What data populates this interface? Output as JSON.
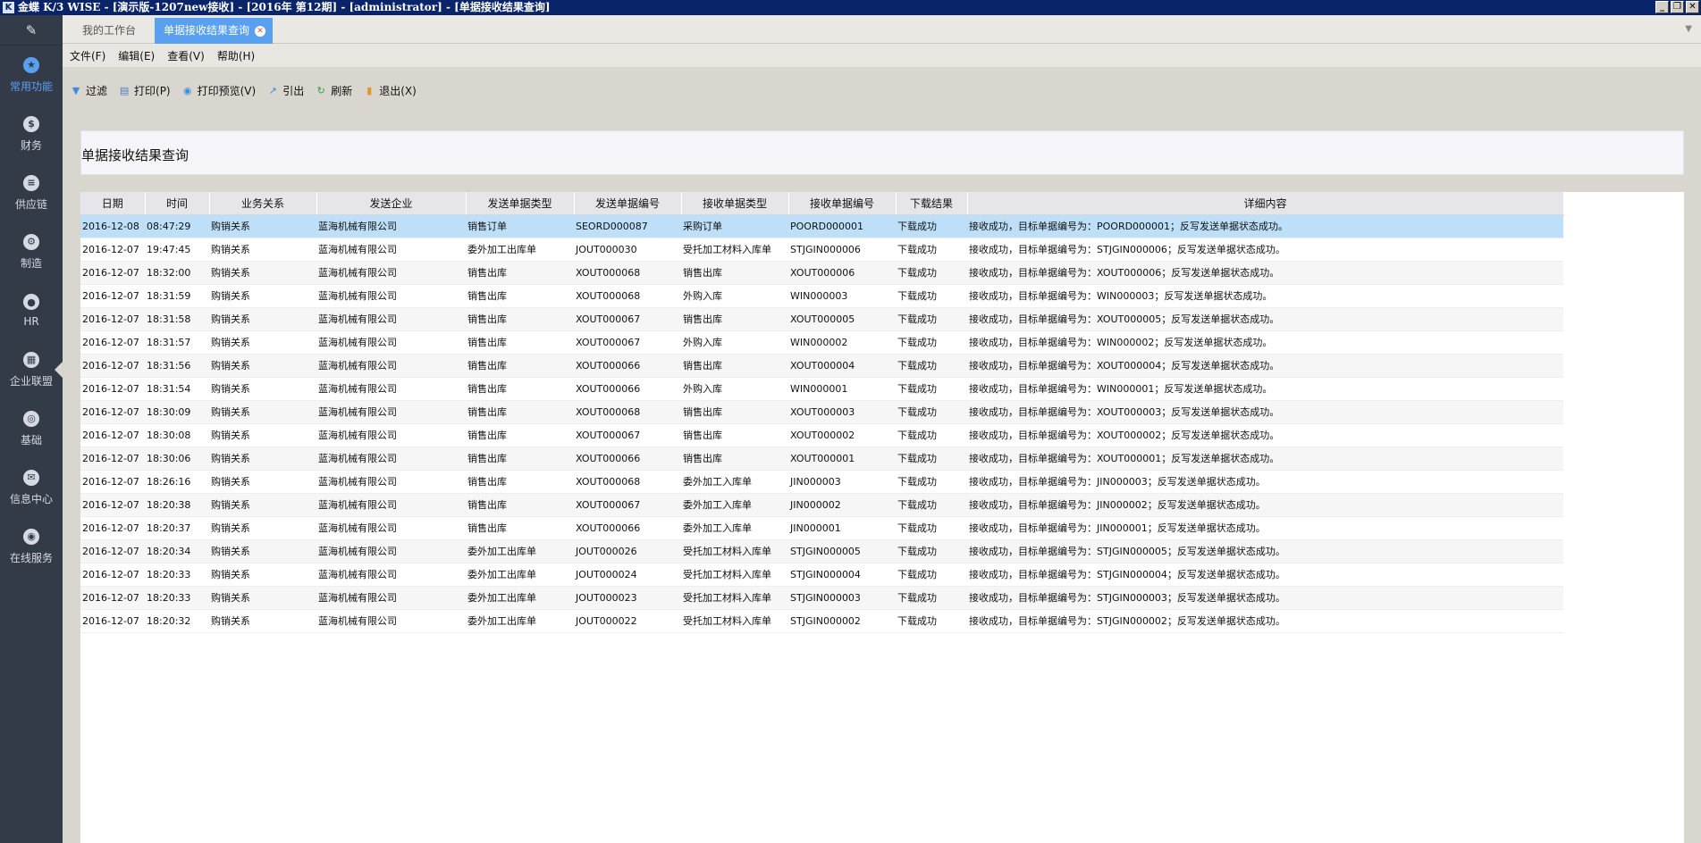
{
  "titlebar": {
    "logo": "K",
    "title": "金蝶 K/3 WISE - [演示版-1207new接收] - [2016年 第12期] - [administrator] - [单据接收结果查询]",
    "minimize": "_",
    "restore": "❐",
    "close": "✕"
  },
  "sidebar": {
    "top_icon": "edit-icon",
    "top_glyph": "✎",
    "items": [
      {
        "label": "常用功能",
        "icon": "star-icon",
        "glyph": "★"
      },
      {
        "label": "财务",
        "icon": "dollar-icon",
        "glyph": "$"
      },
      {
        "label": "供应链",
        "icon": "database-icon",
        "glyph": "≡"
      },
      {
        "label": "制造",
        "icon": "gear-icon",
        "glyph": "⚙"
      },
      {
        "label": "HR",
        "icon": "people-icon",
        "glyph": "●"
      },
      {
        "label": "企业联盟",
        "icon": "grid-icon",
        "glyph": "▦"
      },
      {
        "label": "基础",
        "icon": "settings-icon",
        "glyph": "◎"
      },
      {
        "label": "信息中心",
        "icon": "mail-icon",
        "glyph": "✉"
      },
      {
        "label": "在线服务",
        "icon": "headset-icon",
        "glyph": "◉"
      }
    ]
  },
  "tabs": {
    "home": "我的工作台",
    "active": "单据接收结果查询",
    "close": "✕",
    "dropdown": "▼"
  },
  "menu": [
    "文件(F)",
    "编辑(E)",
    "查看(V)",
    "帮助(H)"
  ],
  "toolbar": [
    {
      "label": "过滤",
      "icon": "filter-icon",
      "glyph": "▼",
      "cls": "i-filter"
    },
    {
      "label": "打印(P)",
      "icon": "printer-icon",
      "glyph": "▤",
      "cls": "i-print"
    },
    {
      "label": "打印预览(V)",
      "icon": "preview-icon",
      "glyph": "◉",
      "cls": "i-preview"
    },
    {
      "label": "引出",
      "icon": "export-icon",
      "glyph": "↗",
      "cls": "i-export"
    },
    {
      "label": "刷新",
      "icon": "refresh-icon",
      "glyph": "↻",
      "cls": "i-refresh"
    },
    {
      "label": "退出(X)",
      "icon": "exit-icon",
      "glyph": "▮",
      "cls": "i-exit"
    }
  ],
  "page_title": "单据接收结果查询",
  "table": {
    "columns": [
      "日期",
      "时间",
      "业务关系",
      "发送企业",
      "发送单据类型",
      "发送单据编号",
      "接收单据类型",
      "接收单据编号",
      "下载结果",
      "详细内容"
    ],
    "rows": [
      [
        "2016-12-08",
        "08:47:29",
        "购销关系",
        "蓝海机械有限公司",
        "销售订单",
        "SEORD000087",
        "采购订单",
        "POORD000001",
        "下载成功",
        "接收成功，目标单据编号为：POORD000001；反写发送单据状态成功。"
      ],
      [
        "2016-12-07",
        "19:47:45",
        "购销关系",
        "蓝海机械有限公司",
        "委外加工出库单",
        "JOUT000030",
        "受托加工材料入库单",
        "STJGIN000006",
        "下载成功",
        "接收成功，目标单据编号为：STJGIN000006；反写发送单据状态成功。"
      ],
      [
        "2016-12-07",
        "18:32:00",
        "购销关系",
        "蓝海机械有限公司",
        "销售出库",
        "XOUT000068",
        "销售出库",
        "XOUT000006",
        "下载成功",
        "接收成功，目标单据编号为：XOUT000006；反写发送单据状态成功。"
      ],
      [
        "2016-12-07",
        "18:31:59",
        "购销关系",
        "蓝海机械有限公司",
        "销售出库",
        "XOUT000068",
        "外购入库",
        "WIN000003",
        "下载成功",
        "接收成功，目标单据编号为：WIN000003；反写发送单据状态成功。"
      ],
      [
        "2016-12-07",
        "18:31:58",
        "购销关系",
        "蓝海机械有限公司",
        "销售出库",
        "XOUT000067",
        "销售出库",
        "XOUT000005",
        "下载成功",
        "接收成功，目标单据编号为：XOUT000005；反写发送单据状态成功。"
      ],
      [
        "2016-12-07",
        "18:31:57",
        "购销关系",
        "蓝海机械有限公司",
        "销售出库",
        "XOUT000067",
        "外购入库",
        "WIN000002",
        "下载成功",
        "接收成功，目标单据编号为：WIN000002；反写发送单据状态成功。"
      ],
      [
        "2016-12-07",
        "18:31:56",
        "购销关系",
        "蓝海机械有限公司",
        "销售出库",
        "XOUT000066",
        "销售出库",
        "XOUT000004",
        "下载成功",
        "接收成功，目标单据编号为：XOUT000004；反写发送单据状态成功。"
      ],
      [
        "2016-12-07",
        "18:31:54",
        "购销关系",
        "蓝海机械有限公司",
        "销售出库",
        "XOUT000066",
        "外购入库",
        "WIN000001",
        "下载成功",
        "接收成功，目标单据编号为：WIN000001；反写发送单据状态成功。"
      ],
      [
        "2016-12-07",
        "18:30:09",
        "购销关系",
        "蓝海机械有限公司",
        "销售出库",
        "XOUT000068",
        "销售出库",
        "XOUT000003",
        "下载成功",
        "接收成功，目标单据编号为：XOUT000003；反写发送单据状态成功。"
      ],
      [
        "2016-12-07",
        "18:30:08",
        "购销关系",
        "蓝海机械有限公司",
        "销售出库",
        "XOUT000067",
        "销售出库",
        "XOUT000002",
        "下载成功",
        "接收成功，目标单据编号为：XOUT000002；反写发送单据状态成功。"
      ],
      [
        "2016-12-07",
        "18:30:06",
        "购销关系",
        "蓝海机械有限公司",
        "销售出库",
        "XOUT000066",
        "销售出库",
        "XOUT000001",
        "下载成功",
        "接收成功，目标单据编号为：XOUT000001；反写发送单据状态成功。"
      ],
      [
        "2016-12-07",
        "18:26:16",
        "购销关系",
        "蓝海机械有限公司",
        "销售出库",
        "XOUT000068",
        "委外加工入库单",
        "JIN000003",
        "下载成功",
        "接收成功，目标单据编号为：JIN000003；反写发送单据状态成功。"
      ],
      [
        "2016-12-07",
        "18:20:38",
        "购销关系",
        "蓝海机械有限公司",
        "销售出库",
        "XOUT000067",
        "委外加工入库单",
        "JIN000002",
        "下载成功",
        "接收成功，目标单据编号为：JIN000002；反写发送单据状态成功。"
      ],
      [
        "2016-12-07",
        "18:20:37",
        "购销关系",
        "蓝海机械有限公司",
        "销售出库",
        "XOUT000066",
        "委外加工入库单",
        "JIN000001",
        "下载成功",
        "接收成功，目标单据编号为：JIN000001；反写发送单据状态成功。"
      ],
      [
        "2016-12-07",
        "18:20:34",
        "购销关系",
        "蓝海机械有限公司",
        "委外加工出库单",
        "JOUT000026",
        "受托加工材料入库单",
        "STJGIN000005",
        "下载成功",
        "接收成功，目标单据编号为：STJGIN000005；反写发送单据状态成功。"
      ],
      [
        "2016-12-07",
        "18:20:33",
        "购销关系",
        "蓝海机械有限公司",
        "委外加工出库单",
        "JOUT000024",
        "受托加工材料入库单",
        "STJGIN000004",
        "下载成功",
        "接收成功，目标单据编号为：STJGIN000004；反写发送单据状态成功。"
      ],
      [
        "2016-12-07",
        "18:20:33",
        "购销关系",
        "蓝海机械有限公司",
        "委外加工出库单",
        "JOUT000023",
        "受托加工材料入库单",
        "STJGIN000003",
        "下载成功",
        "接收成功，目标单据编号为：STJGIN000003；反写发送单据状态成功。"
      ],
      [
        "2016-12-07",
        "18:20:32",
        "购销关系",
        "蓝海机械有限公司",
        "委外加工出库单",
        "JOUT000022",
        "受托加工材料入库单",
        "STJGIN000002",
        "下载成功",
        "接收成功，目标单据编号为：STJGIN000002；反写发送单据状态成功。"
      ]
    ]
  }
}
